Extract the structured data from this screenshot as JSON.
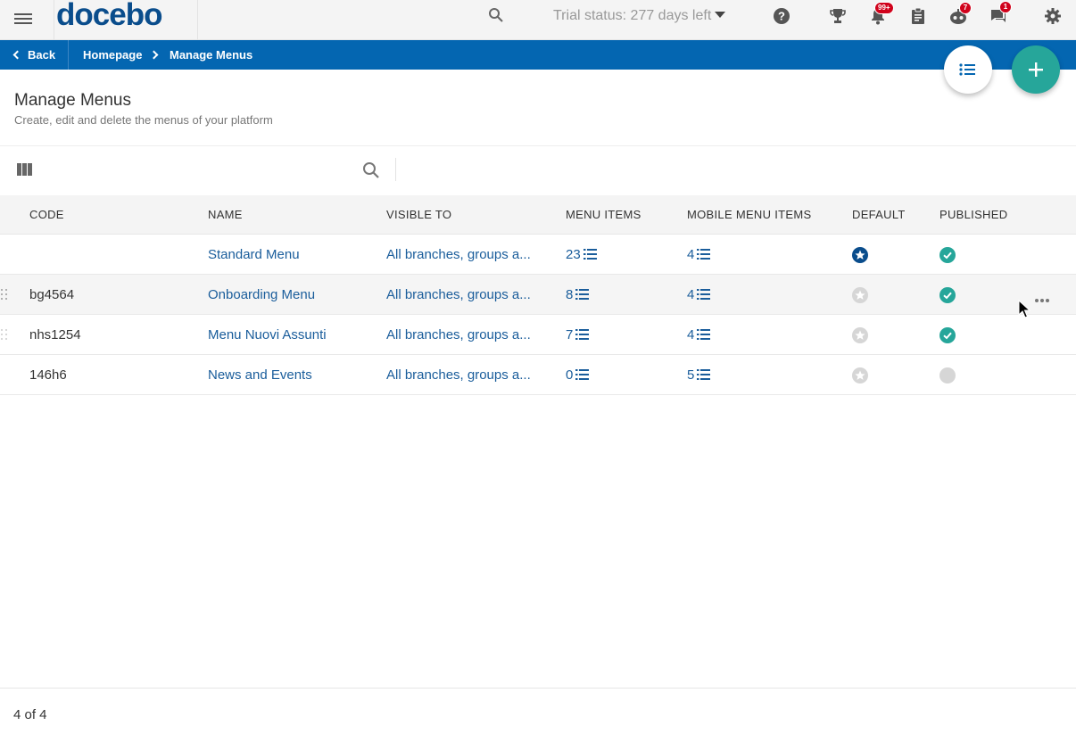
{
  "topbar": {
    "logo_text": "docebo",
    "logo_mark": "®",
    "trial_status": "Trial status: 277 days left",
    "notifications_badge": "99+",
    "gamification_badge": "7",
    "messages_badge": "1",
    "icons": [
      "menu-icon",
      "search-icon",
      "help-icon",
      "trophy-icon",
      "bell-icon",
      "clipboard-icon",
      "robot-icon",
      "chat-icon",
      "gear-icon"
    ]
  },
  "breadcrumb": {
    "back": "Back",
    "home": "Homepage",
    "current": "Manage Menus"
  },
  "page": {
    "title": "Manage Menus",
    "subtitle": "Create, edit and delete the menus of your platform"
  },
  "table": {
    "headers": {
      "code": "CODE",
      "name": "NAME",
      "visible_to": "VISIBLE TO",
      "menu_items": "MENU ITEMS",
      "mobile_menu_items": "MOBILE MENU ITEMS",
      "default": "DEFAULT",
      "published": "PUBLISHED"
    },
    "rows": [
      {
        "code": "",
        "name": "Standard Menu",
        "visible_to": "All branches, groups a...",
        "menu_items": "23",
        "mobile_menu_items": "4",
        "default": true,
        "published": true
      },
      {
        "code": "bg4564",
        "name": "Onboarding Menu",
        "visible_to": "All branches, groups a...",
        "menu_items": "8",
        "mobile_menu_items": "4",
        "default": false,
        "published": true
      },
      {
        "code": "nhs1254",
        "name": "Menu Nuovi Assunti",
        "visible_to": "All branches, groups a...",
        "menu_items": "7",
        "mobile_menu_items": "4",
        "default": false,
        "published": true
      },
      {
        "code": "146h6",
        "name": "News and Events",
        "visible_to": "All branches, groups a...",
        "menu_items": "0",
        "mobile_menu_items": "5",
        "default": false,
        "published": false
      }
    ]
  },
  "footer": {
    "count": "4 of 4"
  },
  "colors": {
    "brand": "#0466b1",
    "accent": "#26a69a",
    "link": "#1a5d9b",
    "badge": "#d0021b"
  }
}
